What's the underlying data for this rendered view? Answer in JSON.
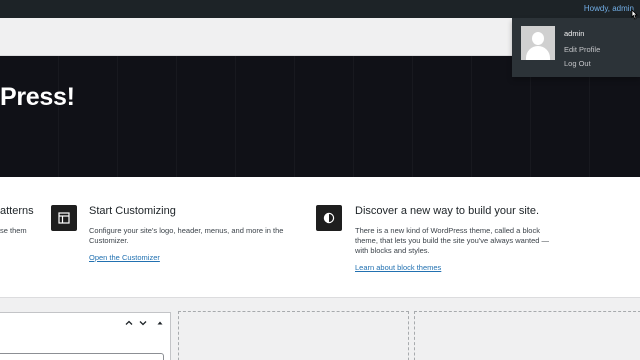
{
  "adminbar": {
    "howdy": "Howdy, admin"
  },
  "hero": {
    "title": "Press!"
  },
  "user_menu": {
    "name": "admin",
    "edit_profile": "Edit Profile",
    "log_out": "Log Out"
  },
  "welcome": {
    "partial": {
      "title": "atterns",
      "desc": "se them"
    },
    "customize": {
      "title": "Start Customizing",
      "desc_line1": "Configure your site's logo, header, menus, and more in the",
      "desc_line2": "Customizer.",
      "link": "Open the Customizer",
      "icon": "layout-icon"
    },
    "block_themes": {
      "title": "Discover a new way to build your site.",
      "desc_line1": "There is a new kind of WordPress theme, called a block",
      "desc_line2": "theme, that lets you build the site you've always wanted —",
      "desc_line3": "with blocks and styles.",
      "link": "Learn about block themes",
      "icon": "contrast-icon"
    }
  },
  "colors": {
    "adminbar_bg": "#1d2327",
    "hero_bg": "#101117",
    "link": "#2271b1",
    "dropdown_bg": "#2c3338"
  }
}
